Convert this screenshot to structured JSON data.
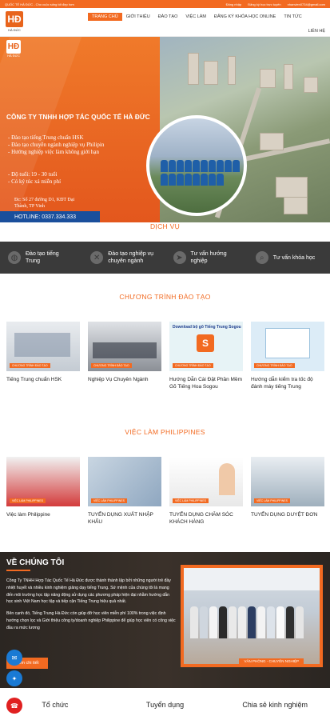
{
  "topbar": {
    "left": "QUỐC TẾ HÀ ĐỨC - Cho cuộc sống tốt đẹp hơn",
    "links": [
      "Đăng nhập",
      "Đăng ký học trực tuyến",
      "nhanvien0734@gmail.com"
    ]
  },
  "logo": {
    "mark": "HĐ",
    "text": "HÀ ĐỨC"
  },
  "nav": {
    "items": [
      "TRANG CHỦ",
      "GIỚI THIỆU",
      "ĐÀO TẠO",
      "VIỆC LÀM",
      "ĐĂNG KÝ KHÓA HỌC ONLINE",
      "TIN TỨC"
    ],
    "second_row": "LIÊN HỆ"
  },
  "hero": {
    "company": "CÔNG TY TNHH HỢP TÁC QUỐC TẾ HÀ ĐỨC",
    "bullets": [
      "- Đào tạo tiếng Trung chuẩn HSK",
      "- Đào tạo chuyên ngành nghiệp vụ Philipin",
      "- Hướng nghiệp việc làm không giới hạn"
    ],
    "bullets2": [
      "- Độ tuổi: 19 - 30 tuổi",
      "- Có ký túc xá miễn phí"
    ],
    "hotline": "HOTLINE: 0337.334.333",
    "address": [
      "Đc: Số 27 đường D1, KĐT Đại",
      "Thành, TP Vinh"
    ]
  },
  "services": {
    "title": "DỊCH VỤ",
    "items": [
      {
        "label": "Đào tạo tiếng Trung",
        "icon": "globe-icon"
      },
      {
        "label": "Đào tạo nghiệp vụ chuyên ngành",
        "icon": "tools-icon"
      },
      {
        "label": "Tư vấn hướng nghiệp",
        "icon": "paper-plane-icon"
      },
      {
        "label": "Tư vấn khóa học",
        "icon": "search-icon"
      }
    ]
  },
  "training": {
    "title": "CHƯƠNG TRÌNH ĐÀO TẠO",
    "tag": "CHƯƠNG TRÌNH ĐÀO TẠO",
    "cards": [
      "Tiếng Trung chuẩn HSK",
      "Nghiệp Vụ Chuyên Ngành",
      "Hướng Dẫn Cài Đặt Phần Mềm Gõ Tiếng Hoa Sogou",
      "Hướng dẫn kiểm tra tốc độ đánh máy tiếng Trung"
    ],
    "card3_banner": "Download bộ gõ Tiếng Trung Sogou"
  },
  "jobs": {
    "title": "VIỆC LÀM PHILIPPINES",
    "tag": "VIỆC LÀM PHILIPPINES",
    "cards": [
      "Việc làm Philippine",
      "TUYỂN DỤNG XUẤT NHẬP KHẨU",
      "TUYỂN DỤNG CHĂM SÓC KHÁCH HÀNG",
      "TUYỂN DỤNG DUYỆT ĐƠN"
    ]
  },
  "about": {
    "title": "VỀ CHÚNG TÔI",
    "para1": "Công Ty TNHH Hợp Tác Quốc Tế Hà Đức được thành thành lập bởi những người trẻ đầy nhiệt huyết và nhiều kinh nghiệm giảng dạy tiếng Trung. Sứ mệnh của chúng tôi là mang đến môi trường học tập năng động sử dụng các phương pháp hiện đại nhằm hướng dẫn học sinh Việt Nam học tập và tiếp cận Tiếng Trung hiệu quả nhất.",
    "para2": "Bên cạnh đó, Tiếng Trung Hà Đức còn giúp đỡ học viên miễn phí 100% trong việc định hướng chọn lọc và Giới thiệu công ty/doanh nghiệp Philippine để giúp học viên có công việc đầu ra mức lương",
    "button": "Xem chi tiết",
    "photo_caption": "VĂN PHÒNG - CHUYÊN NGHIỆP"
  },
  "bottom": [
    "Tổ chức",
    "Tuyển dụng",
    "Chia sẻ kinh nghiệm"
  ],
  "colors": {
    "accent": "#f26a21",
    "dark": "#3a3a3a",
    "blue": "#1a4f9c"
  }
}
